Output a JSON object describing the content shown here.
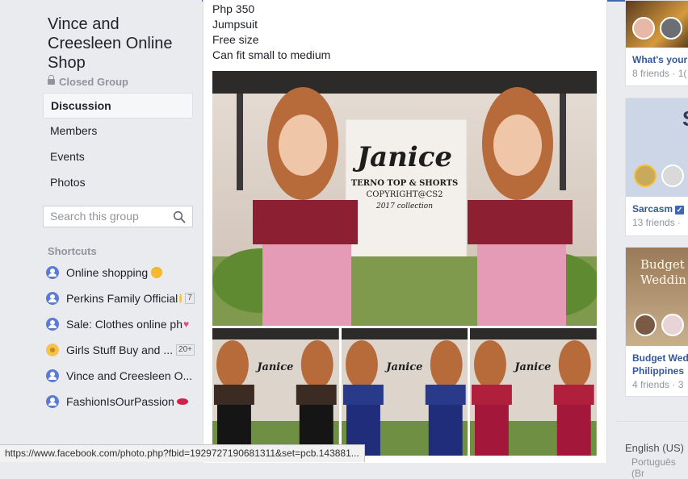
{
  "group": {
    "title": "Vince and Creesleen Online Shop",
    "privacy": "Closed Group"
  },
  "nav": {
    "items": [
      {
        "label": "Discussion"
      },
      {
        "label": "Members"
      },
      {
        "label": "Events"
      },
      {
        "label": "Photos"
      }
    ]
  },
  "search": {
    "placeholder": "Search this group"
  },
  "shortcuts": {
    "heading": "Shortcuts",
    "items": [
      {
        "label": "Online shopping",
        "emoji": "heart-eyes-emoji"
      },
      {
        "label": "Perkins Family Official",
        "badge": "7"
      },
      {
        "label": "Sale: Clothes online ph",
        "emoji": "heart-emoji"
      },
      {
        "label": "Girls Stuff Buy and ...",
        "badge": "20+"
      },
      {
        "label": "Vince and Creesleen O..."
      },
      {
        "label": "FashionIsOurPassion",
        "emoji": "lips-emoji"
      }
    ]
  },
  "post": {
    "lines": [
      "Php 350",
      "Jumpsuit",
      "Free size",
      "Can fit small to medium"
    ],
    "photo": {
      "name": "Janice",
      "caption1": "TERNO TOP & SHORTS",
      "caption2": "COPYRIGHT@CS2",
      "caption3": "2017 collection"
    }
  },
  "suggestions": [
    {
      "title": "What's your",
      "sub": "8 friends · 1("
    },
    {
      "title": "Sarcasm",
      "sub": "13 friends ·",
      "verified": true
    },
    {
      "title": "Budget Wed",
      "title2": "Philippines",
      "sub": "4 friends · 3",
      "image_text": "Budget Weddin"
    }
  ],
  "footer": {
    "language": "English (US)",
    "language2": "Português (Br"
  },
  "status_bar": {
    "url": "https://www.facebook.com/photo.php?fbid=1929727190681311&set=pcb.143881..."
  },
  "colors": {
    "brand": "#4267b2",
    "link": "#365899",
    "muted": "#90949c"
  }
}
